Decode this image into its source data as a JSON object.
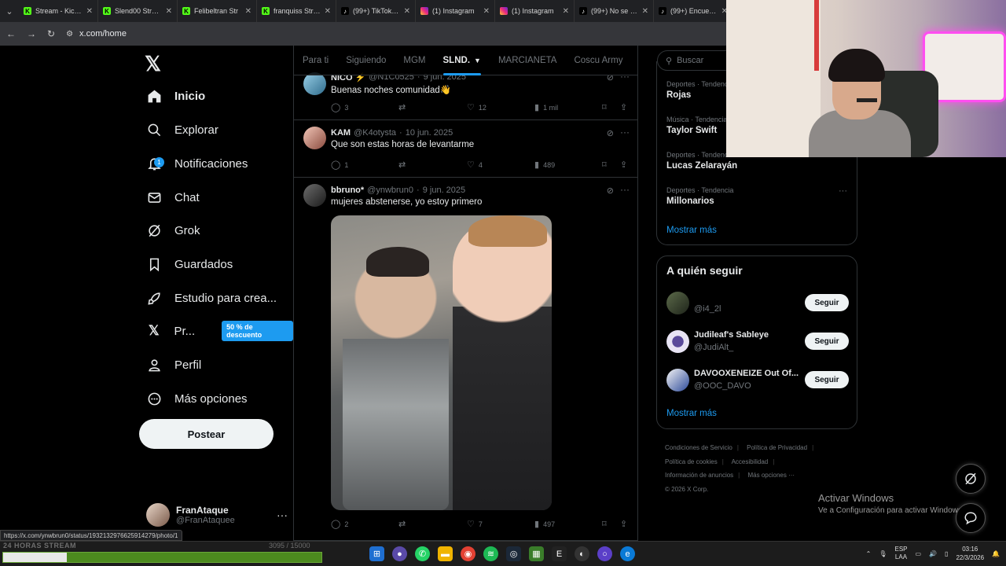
{
  "browser": {
    "tabs": [
      {
        "title": "Stream - Kick D",
        "icon": "kick-icon"
      },
      {
        "title": "Slend00 Stream",
        "icon": "kick-icon"
      },
      {
        "title": "Felibeltran Str",
        "icon": "kick-icon"
      },
      {
        "title": "franquiss Strea",
        "icon": "kick-icon"
      },
      {
        "title": "(99+) TikTok - N",
        "icon": "tiktok-icon"
      },
      {
        "title": "(1) Instagram",
        "icon": "instagram-icon"
      },
      {
        "title": "(1) Instagram",
        "icon": "instagram-icon"
      },
      {
        "title": "(99+) No se lo c",
        "icon": "tiktok-icon"
      },
      {
        "title": "(99+) Encuentr",
        "icon": "tiktok-icon"
      }
    ],
    "url": "x.com/home",
    "status_url": "https://x.com/ynwbrun0/status/1932132976625914279/photo/1"
  },
  "nav": {
    "items": [
      {
        "label": "Inicio",
        "icon": "home-icon"
      },
      {
        "label": "Explorar",
        "icon": "search-icon"
      },
      {
        "label": "Notificaciones",
        "icon": "bell-icon",
        "badge": "1"
      },
      {
        "label": "Chat",
        "icon": "mail-icon"
      },
      {
        "label": "Grok",
        "icon": "grok-icon"
      },
      {
        "label": "Guardados",
        "icon": "bookmark-icon"
      },
      {
        "label": "Estudio para crea...",
        "icon": "rocket-icon"
      },
      {
        "label": "Pr...",
        "icon": "x-premium-icon",
        "badge_text": "50 % de descuento"
      },
      {
        "label": "Perfil",
        "icon": "person-icon"
      },
      {
        "label": "Más opciones",
        "icon": "more-circle-icon"
      }
    ],
    "post_button": "Postear",
    "profile": {
      "name": "FranAtaque",
      "handle": "@FranAtaquee"
    }
  },
  "feed": {
    "tabs": [
      "Para ti",
      "Siguiendo",
      "MGM",
      "SLND.",
      "MARCIANETA",
      "Coscu Army"
    ],
    "active_tab": "SLND.",
    "posts": [
      {
        "name": "NICO ⚡",
        "handle": "@N1C0525",
        "date": "9 jun. 2025",
        "text": "Buenas noches comunidad👋",
        "replies": "3",
        "likes": "12",
        "views": "1 mil"
      },
      {
        "name": "KAM",
        "handle": "@K4otysta",
        "date": "10 jun. 2025",
        "text": "Que son estas horas de levantarme",
        "replies": "1",
        "likes": "4",
        "views": "489"
      },
      {
        "name": "bbruno*",
        "handle": "@ynwbrun0",
        "date": "9 jun. 2025",
        "text": "mujeres abstenerse, yo estoy primero",
        "replies": "2",
        "likes": "7",
        "views": "497"
      }
    ]
  },
  "sidebar": {
    "search_placeholder": "Buscar",
    "trends": [
      {
        "meta": "Deportes · Tendencia",
        "name": "Rojas"
      },
      {
        "meta": "Música · Tendencia",
        "name": "Taylor Swift"
      },
      {
        "meta": "Deportes · Tendencia",
        "name": "Lucas Zelarayán"
      },
      {
        "meta": "Deportes · Tendencia",
        "name": "Millonarios"
      }
    ],
    "show_more": "Mostrar más",
    "who_to_follow": {
      "title": "A quién seguir",
      "users": [
        {
          "name": "",
          "handle": "@i4_2l"
        },
        {
          "name": "Judileaf's Sableye",
          "handle": "@JudiAlt_"
        },
        {
          "name": "DAVOOXENEIZE Out Of...",
          "handle": "@OOC_DAVO"
        }
      ],
      "follow_label": "Seguir",
      "show_more": "Mostrar más"
    },
    "footer": {
      "links": [
        "Condiciones de Servicio",
        "Política de Privacidad",
        "Política de cookies",
        "Accesibilidad",
        "Información de anuncios",
        "Más opciones ···"
      ],
      "copyright": "© 2026 X Corp."
    }
  },
  "windows": {
    "activate_title": "Activar Windows",
    "activate_sub": "Ve a Configuración para activar Windows",
    "lang1": "ESP",
    "lang2": "LAA",
    "time": "03:16",
    "date": "22/3/2026"
  },
  "stream_overlay": {
    "label": "24 HORAS STREAM",
    "count": "3095 / 15000",
    "progress": 0.2
  },
  "colors": {
    "accent": "#1d9bf0",
    "background": "#000000",
    "muted": "#71767b"
  }
}
